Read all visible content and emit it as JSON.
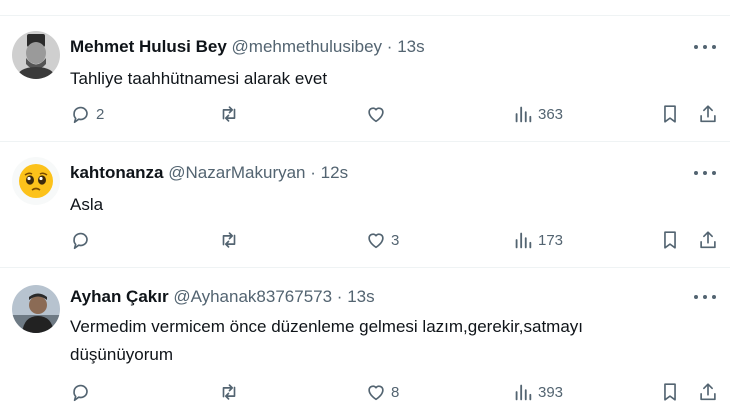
{
  "tweets": [
    {
      "name": "Mehmet Hulusi Bey",
      "handle": "@mehmethulusibey",
      "separator": "·",
      "time": "13s",
      "text": "Tahliye taahhütnamesi alarak evet",
      "replies": "2",
      "retweets": "",
      "likes": "",
      "views": "363"
    },
    {
      "name": "kahtonanza",
      "handle": "@NazarMakuryan",
      "separator": "·",
      "time": "12s",
      "text": "Asla",
      "replies": "",
      "retweets": "",
      "likes": "3",
      "views": "173"
    },
    {
      "name": "Ayhan Çakır",
      "handle": "@Ayhanak83767573",
      "separator": "·",
      "time": "13s",
      "text": "Vermedim vermicem önce düzenleme gelmesi lazım,gerekir,satmayı düşünüyorum",
      "replies": "",
      "retweets": "",
      "likes": "8",
      "views": "393"
    }
  ],
  "icons": {
    "reply": "reply-icon",
    "retweet": "retweet-icon",
    "like": "heart-icon",
    "views": "views-chart-icon",
    "bookmark": "bookmark-icon",
    "share": "share-icon",
    "more": "more-options-icon"
  },
  "colors": {
    "text": "#0f1419",
    "secondary": "#536471",
    "divider": "#eff3f4"
  }
}
